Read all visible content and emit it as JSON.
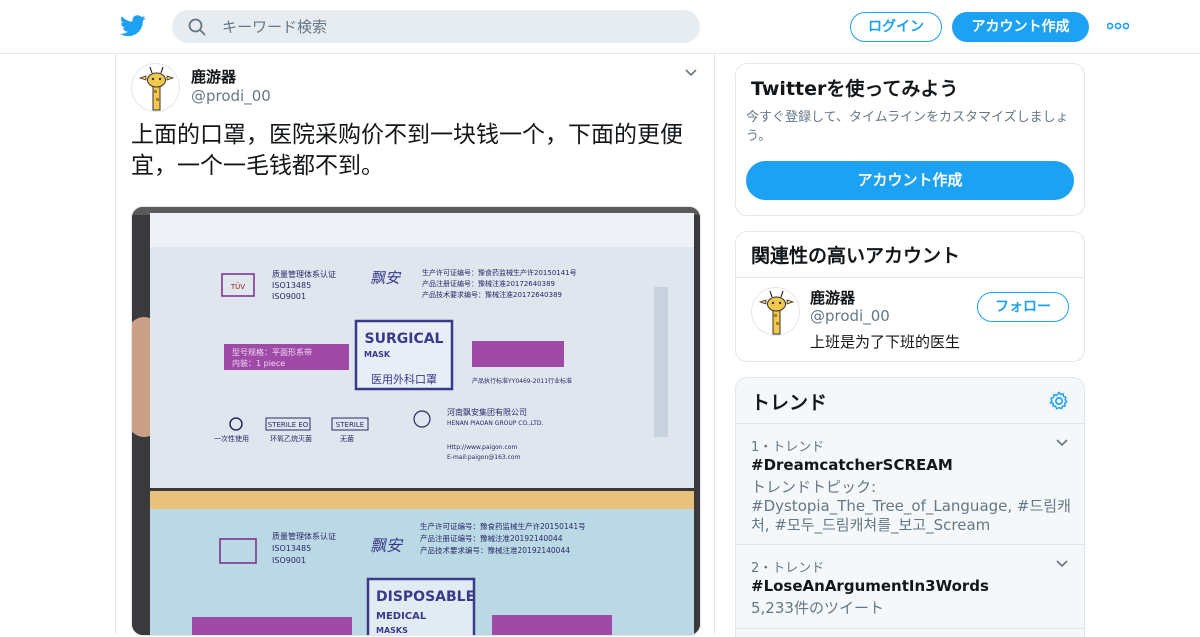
{
  "header": {
    "search_placeholder": "キーワード検索",
    "login_label": "ログイン",
    "signup_label": "アカウント作成"
  },
  "tweet": {
    "name": "鹿游器",
    "handle": "@prodi_00",
    "text": "上面的口罩，医院采购价不到一块钱一个，下面的更便宜，一个一毛钱都不到。",
    "media_top": {
      "brand": "飘安",
      "cert_title": "质量管理体系认证",
      "cert_1": "ISO13485",
      "cert_2": "ISO9001",
      "license_1": "生产许可证编号：豫食药监械生产许20150141号",
      "license_2": "产品注册证编号：豫械注准20172640389",
      "license_3": "产品技术要求编号：豫械注准20172640389",
      "surgical": "SURGICAL",
      "mask": "MASK",
      "mask_cn": "医用外科口罩",
      "spec": "型号规格：平面形系带",
      "pack": "内装：1 piece",
      "standard": "产品执行标准YY0469-2011行业标准",
      "sterile_1": "STERILE EO",
      "sterile_2": "STERILE",
      "label_1": "一次性使用",
      "label_2": "环氧乙烷灭菌",
      "label_3": "无菌",
      "company_cn": "河南飘安集团有限公司",
      "company_en": "HENAN PIAOAN GROUP CO.,LTD.",
      "web": "Http://www.paigon.com",
      "email": "E-mail:paigon@163.com"
    },
    "media_bottom": {
      "brand": "飘安",
      "cert_title": "质量管理体系认证",
      "cert_1": "ISO13485",
      "cert_2": "ISO9001",
      "license_1": "生产许可证编号：豫食药监械生产许20150141号",
      "license_2": "产品注册证编号：豫械注准20192140044",
      "license_3": "产品技术要求编号：豫械注准20192140044",
      "title_1": "DISPOSABLE",
      "title_2": "MEDICAL",
      "title_3": "MASKS"
    }
  },
  "sidebar": {
    "try_title": "Twitterを使ってみよう",
    "try_desc": "今すぐ登録して、タイムラインをカスタマイズしましょう。",
    "try_button": "アカウント作成",
    "related_title": "関連性の高いアカウント",
    "related_name": "鹿游器",
    "related_handle": "@prodi_00",
    "related_bio": "上班是为了下班的医生",
    "follow_label": "フォロー",
    "trends_title": "トレンド",
    "trends": [
      {
        "meta": "1・トレンド",
        "name": "#DreamcatcherSCREAM",
        "sub": "トレンドトピック: #Dystopia_The_Tree_of_Language, #드림캐처, #모두_드림캐쳐를_보고_Scream"
      },
      {
        "meta": "2・トレンド",
        "name": "#LoseAnArgumentIn3Words",
        "sub": "5,233件のツイート"
      }
    ]
  },
  "colors": {
    "accent": "#1da1f2",
    "border": "#e1e8ed",
    "muted": "#657786",
    "trend_bg": "#f5f8fa"
  }
}
